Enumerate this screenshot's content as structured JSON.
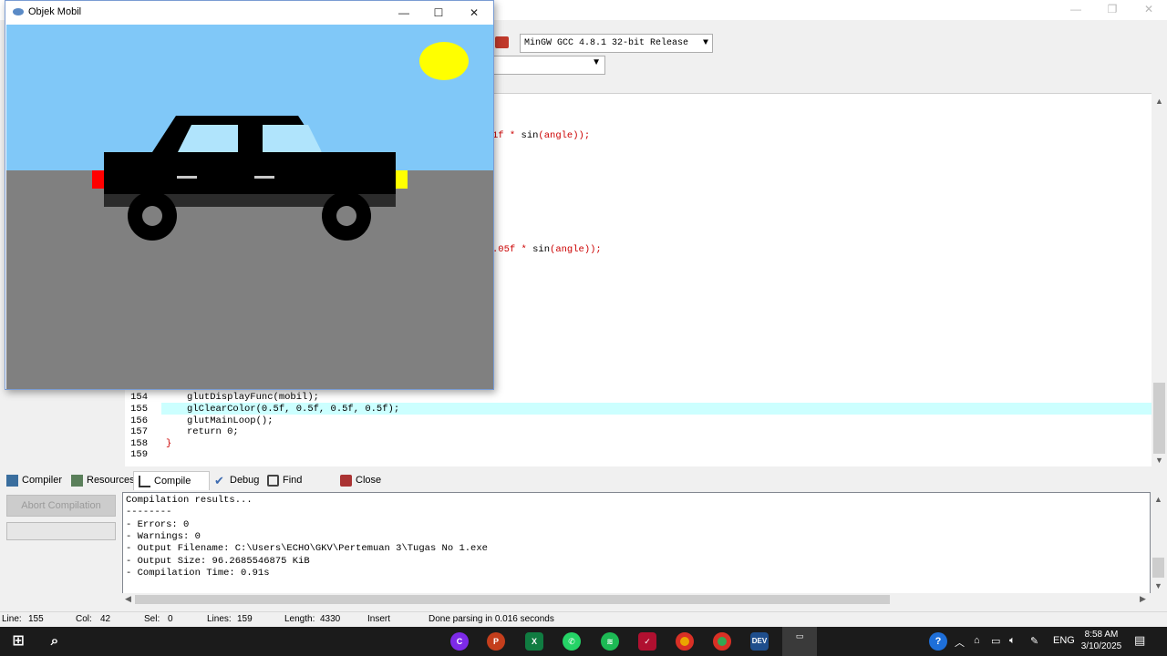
{
  "ide": {
    "compiler": "MinGW GCC 4.8.1 32-bit Release",
    "code_fragments": {
      "frag1_pre": "1f * ",
      "frag1_fn": "sin",
      "frag1_post": "(angle));",
      "frag2_pre": ".05f * ",
      "frag2_fn": "sin",
      "frag2_post": "(angle));"
    },
    "lines": [
      {
        "num": "154",
        "text": "glutDisplayFunc(mobil);"
      },
      {
        "num": "155",
        "text": "glClearColor(0.5f, 0.5f, 0.5f, 0.5f);"
      },
      {
        "num": "156",
        "text": "glutMainLoop();"
      },
      {
        "num": "157",
        "text": "return 0;"
      },
      {
        "num": "158",
        "text": "}"
      },
      {
        "num": "159",
        "text": ""
      }
    ],
    "tabs": [
      "Compiler",
      "Resources",
      "Compile Log",
      "Debug",
      "Find Results",
      "Close"
    ],
    "abort_label": "Abort Compilation",
    "log": [
      "Compilation results...",
      "--------",
      "- Errors: 0",
      "- Warnings: 0",
      "- Output Filename: C:\\Users\\ECHO\\GKV\\Pertemuan 3\\Tugas No 1.exe",
      "- Output Size: 96.2685546875 KiB",
      "- Compilation Time: 0.91s"
    ],
    "status": {
      "line_label": "Line:",
      "line": "155",
      "col_label": "Col:",
      "col": "42",
      "sel_label": "Sel:",
      "sel": "0",
      "lines_label": "Lines:",
      "lines": "159",
      "length_label": "Length:",
      "length": "4330",
      "mode": "Insert",
      "message": "Done parsing in 0.016 seconds"
    }
  },
  "glut_window": {
    "title": "Objek Mobil",
    "sky_color": "#80c8f8",
    "road_color": "#808080",
    "sun_color": "#ffff00",
    "car_color": "#000000",
    "window_color": "#b0e4fc",
    "taillight_color": "#ff0000",
    "headlight_color": "#ffff00"
  },
  "taskbar": {
    "lang": "ENG",
    "time": "8:58 AM",
    "date": "3/10/2025",
    "apps": [
      "start-icon",
      "search-icon",
      "canva-icon",
      "powerpoint-icon",
      "excel-icon",
      "whatsapp-icon",
      "spotify-icon",
      "app-icon",
      "chrome-icon",
      "chrome-profile-icon",
      "devcpp-icon",
      "glut-app-icon"
    ]
  }
}
